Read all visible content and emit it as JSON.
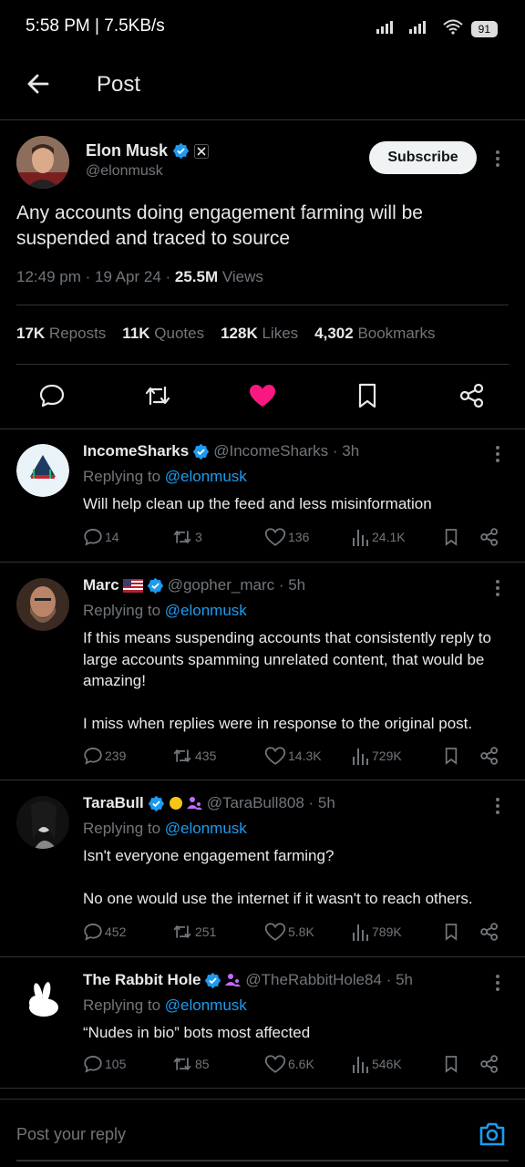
{
  "status_bar": {
    "time": "5:58 PM | 7.5KB/s",
    "battery": "91"
  },
  "header": {
    "title": "Post"
  },
  "post": {
    "author_name": "Elon Musk",
    "author_handle": "@elonmusk",
    "subscribe_label": "Subscribe",
    "text": "Any accounts doing engagement farming will be suspended and traced to source",
    "time": "12:49 pm · 19 Apr 24 · ",
    "views_count": "25.5M",
    "views_label": " Views",
    "stats": {
      "reposts_count": "17K",
      "reposts_label": "Reposts",
      "quotes_count": "11K",
      "quotes_label": "Quotes",
      "likes_count": "128K",
      "likes_label": "Likes",
      "bookmarks_count": "4,302",
      "bookmarks_label": "Bookmarks"
    },
    "liked": true
  },
  "replies": [
    {
      "name": "IncomeSharks",
      "handle": "@IncomeSharks · 3h",
      "replying_prefix": "Replying to ",
      "replying_to": "@elonmusk",
      "text": "Will help clean up the feed and less misinformation",
      "reply_count": "14",
      "repost_count": "3",
      "like_count": "136",
      "view_count": "24.1K"
    },
    {
      "name": "Marc",
      "handle": "@gopher_marc · 5h",
      "replying_prefix": "Replying to ",
      "replying_to": "@elonmusk",
      "text": "If this means suspending accounts that consistently reply to large accounts spamming unrelated content, that would be amazing!\n\nI miss when replies were in response to  the original post.",
      "reply_count": "239",
      "repost_count": "435",
      "like_count": "14.3K",
      "view_count": "729K"
    },
    {
      "name": "TaraBull",
      "handle": "@TaraBull808 · 5h",
      "replying_prefix": "Replying to ",
      "replying_to": "@elonmusk",
      "text": "Isn't everyone engagement farming?\n\nNo one would use the internet if it wasn't to reach others.",
      "reply_count": "452",
      "repost_count": "251",
      "like_count": "5.8K",
      "view_count": "789K"
    },
    {
      "name": "The Rabbit Hole",
      "handle": "@TheRabbitHole84 · 5h",
      "replying_prefix": "Replying to ",
      "replying_to": "@elonmusk",
      "text": "“Nudes in bio” bots most affected",
      "reply_count": "105",
      "repost_count": "85",
      "like_count": "6.6K",
      "view_count": "546K"
    }
  ],
  "composer": {
    "placeholder": "Post your reply"
  },
  "colors": {
    "background": "#000000",
    "accent": "#1d9bf0",
    "like": "#f91880",
    "muted": "#71767b"
  }
}
